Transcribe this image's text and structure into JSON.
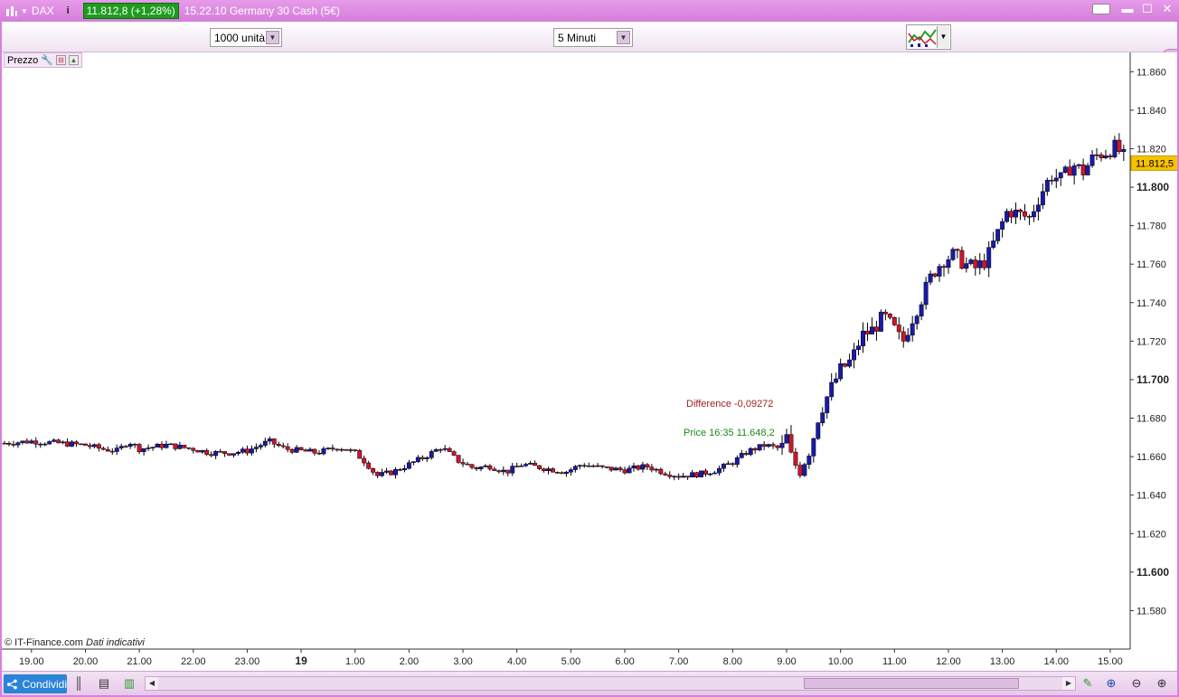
{
  "titlebar": {
    "ticker": "DAX",
    "price_badge": "11.812,8 (+1,28%)",
    "description": "15.22.10 Germany 30 Cash (5€)"
  },
  "toolbar": {
    "units_select": "1000 unità",
    "timeframe_select": "5 Minuti"
  },
  "panel": {
    "label": "Prezzo"
  },
  "footer": {
    "copyright": "© IT-Finance.com",
    "disclaimer": "Dati indicativi",
    "share_label": "Condividi"
  },
  "annotations": {
    "difference": "Difference -0,09272",
    "price": "Price 16:35 11.648,2"
  },
  "colors": {
    "bull": "#1a1aa8",
    "bear": "#d0142e",
    "current_price_bg": "#f7c200",
    "difference_text": "#a02020",
    "price_text": "#1a8a1a",
    "accent": "#d97fe0"
  },
  "chart_data": {
    "type": "candlestick",
    "current_price_label": "11.812,5",
    "current_price": 11812.5,
    "ylim": [
      11560,
      11870
    ],
    "y_ticks": [
      {
        "value": 11860,
        "label": "11.860",
        "bold": false
      },
      {
        "value": 11840,
        "label": "11.840",
        "bold": false
      },
      {
        "value": 11820,
        "label": "11.820",
        "bold": false
      },
      {
        "value": 11800,
        "label": "11.800",
        "bold": true
      },
      {
        "value": 11780,
        "label": "11.780",
        "bold": false
      },
      {
        "value": 11760,
        "label": "11.760",
        "bold": false
      },
      {
        "value": 11740,
        "label": "11.740",
        "bold": false
      },
      {
        "value": 11720,
        "label": "11.720",
        "bold": false
      },
      {
        "value": 11700,
        "label": "11.700",
        "bold": true
      },
      {
        "value": 11680,
        "label": "11.680",
        "bold": false
      },
      {
        "value": 11660,
        "label": "11.660",
        "bold": false
      },
      {
        "value": 11640,
        "label": "11.640",
        "bold": false
      },
      {
        "value": 11620,
        "label": "11.620",
        "bold": false
      },
      {
        "value": 11600,
        "label": "11.600",
        "bold": true
      },
      {
        "value": 11580,
        "label": "11.580",
        "bold": false
      }
    ],
    "x_ticks": [
      {
        "label": "19.00",
        "hour": 19.0,
        "bold": false
      },
      {
        "label": "20.00",
        "hour": 20.0,
        "bold": false
      },
      {
        "label": "21.00",
        "hour": 21.0,
        "bold": false
      },
      {
        "label": "22.00",
        "hour": 22.0,
        "bold": false
      },
      {
        "label": "23.00",
        "hour": 23.0,
        "bold": false
      },
      {
        "label": "19",
        "hour": 24.0,
        "bold": true
      },
      {
        "label": "1.00",
        "hour": 25.0,
        "bold": false
      },
      {
        "label": "2.00",
        "hour": 26.0,
        "bold": false
      },
      {
        "label": "3.00",
        "hour": 27.0,
        "bold": false
      },
      {
        "label": "4.00",
        "hour": 28.0,
        "bold": false
      },
      {
        "label": "5.00",
        "hour": 29.0,
        "bold": false
      },
      {
        "label": "6.00",
        "hour": 30.0,
        "bold": false
      },
      {
        "label": "7.00",
        "hour": 31.0,
        "bold": false
      },
      {
        "label": "8.00",
        "hour": 32.0,
        "bold": false
      },
      {
        "label": "9.00",
        "hour": 33.0,
        "bold": false
      },
      {
        "label": "10.00",
        "hour": 34.0,
        "bold": false
      },
      {
        "label": "11.00",
        "hour": 35.0,
        "bold": false
      },
      {
        "label": "12.00",
        "hour": 36.0,
        "bold": false
      },
      {
        "label": "13.00",
        "hour": 37.0,
        "bold": false
      },
      {
        "label": "14.00",
        "hour": 38.0,
        "bold": false
      },
      {
        "label": "15.00",
        "hour": 39.0,
        "bold": false
      }
    ],
    "x_range_hours": [
      18.45,
      39.37
    ],
    "close_path": [
      [
        18.5,
        11667
      ],
      [
        19.0,
        11668
      ],
      [
        19.5,
        11667
      ],
      [
        20.0,
        11666
      ],
      [
        20.3,
        11664
      ],
      [
        20.6,
        11663
      ],
      [
        20.8,
        11668
      ],
      [
        21.0,
        11664
      ],
      [
        21.5,
        11666
      ],
      [
        22.0,
        11664
      ],
      [
        22.3,
        11662
      ],
      [
        22.7,
        11662
      ],
      [
        23.0,
        11663
      ],
      [
        23.4,
        11668
      ],
      [
        23.7,
        11664
      ],
      [
        24.0,
        11663
      ],
      [
        24.3,
        11662
      ],
      [
        24.7,
        11665
      ],
      [
        25.0,
        11662
      ],
      [
        25.2,
        11657
      ],
      [
        25.4,
        11650
      ],
      [
        25.7,
        11652
      ],
      [
        26.0,
        11656
      ],
      [
        26.3,
        11660
      ],
      [
        26.6,
        11665
      ],
      [
        26.9,
        11658
      ],
      [
        27.2,
        11654
      ],
      [
        27.5,
        11655
      ],
      [
        27.8,
        11652
      ],
      [
        28.1,
        11656
      ],
      [
        28.5,
        11654
      ],
      [
        28.9,
        11652
      ],
      [
        29.2,
        11656
      ],
      [
        29.6,
        11654
      ],
      [
        30.0,
        11653
      ],
      [
        30.4,
        11655
      ],
      [
        30.7,
        11652
      ],
      [
        31.0,
        11650
      ],
      [
        31.4,
        11651
      ],
      [
        31.7,
        11653
      ],
      [
        32.0,
        11657
      ],
      [
        32.3,
        11663
      ],
      [
        32.6,
        11666
      ],
      [
        32.9,
        11664
      ],
      [
        33.0,
        11670
      ],
      [
        33.1,
        11658
      ],
      [
        33.25,
        11653
      ],
      [
        33.45,
        11665
      ],
      [
        33.6,
        11682
      ],
      [
        33.8,
        11694
      ],
      [
        34.0,
        11705
      ],
      [
        34.2,
        11710
      ],
      [
        34.4,
        11723
      ],
      [
        34.6,
        11726
      ],
      [
        34.8,
        11733
      ],
      [
        35.0,
        11726
      ],
      [
        35.15,
        11719
      ],
      [
        35.3,
        11730
      ],
      [
        35.5,
        11742
      ],
      [
        35.7,
        11755
      ],
      [
        35.9,
        11762
      ],
      [
        36.1,
        11765
      ],
      [
        36.3,
        11760
      ],
      [
        36.5,
        11758
      ],
      [
        36.7,
        11762
      ],
      [
        36.9,
        11775
      ],
      [
        37.1,
        11788
      ],
      [
        37.3,
        11786
      ],
      [
        37.5,
        11784
      ],
      [
        37.7,
        11796
      ],
      [
        37.9,
        11806
      ],
      [
        38.1,
        11804
      ],
      [
        38.3,
        11812
      ],
      [
        38.5,
        11808
      ],
      [
        38.7,
        11816
      ],
      [
        38.9,
        11818
      ],
      [
        39.1,
        11821
      ],
      [
        39.3,
        11814
      ]
    ]
  }
}
